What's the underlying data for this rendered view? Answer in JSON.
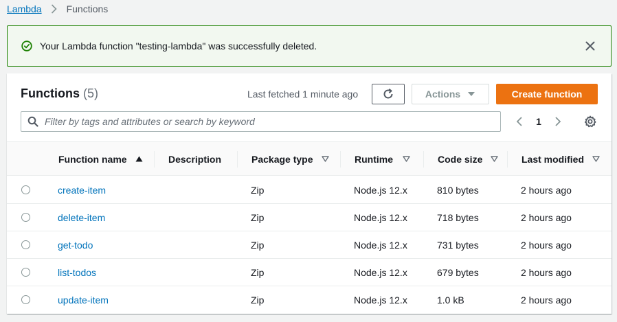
{
  "breadcrumb": {
    "parent": "Lambda",
    "current": "Functions"
  },
  "flash": {
    "message": "Your Lambda function \"testing-lambda\" was successfully deleted."
  },
  "panel": {
    "title": "Functions",
    "count": "(5)",
    "last_fetched": "Last fetched 1 minute ago",
    "actions_label": "Actions",
    "create_label": "Create function",
    "search_placeholder": "Filter by tags and attributes or search by keyword",
    "page": "1"
  },
  "table": {
    "columns": [
      "Function name",
      "Description",
      "Package type",
      "Runtime",
      "Code size",
      "Last modified"
    ],
    "rows": [
      {
        "name": "create-item",
        "description": "",
        "package_type": "Zip",
        "runtime": "Node.js 12.x",
        "code_size": "810 bytes",
        "last_modified": "2 hours ago"
      },
      {
        "name": "delete-item",
        "description": "",
        "package_type": "Zip",
        "runtime": "Node.js 12.x",
        "code_size": "718 bytes",
        "last_modified": "2 hours ago"
      },
      {
        "name": "get-todo",
        "description": "",
        "package_type": "Zip",
        "runtime": "Node.js 12.x",
        "code_size": "731 bytes",
        "last_modified": "2 hours ago"
      },
      {
        "name": "list-todos",
        "description": "",
        "package_type": "Zip",
        "runtime": "Node.js 12.x",
        "code_size": "679 bytes",
        "last_modified": "2 hours ago"
      },
      {
        "name": "update-item",
        "description": "",
        "package_type": "Zip",
        "runtime": "Node.js 12.x",
        "code_size": "1.0 kB",
        "last_modified": "2 hours ago"
      }
    ]
  },
  "colors": {
    "link": "#0073bb",
    "primary_button": "#ec7211",
    "success": "#1d8102",
    "success_bg": "#f2f8f0"
  },
  "icons": [
    "chevron-right-icon",
    "check-circle-icon",
    "close-icon",
    "refresh-icon",
    "caret-down-icon",
    "search-icon",
    "chevron-left-icon",
    "gear-icon",
    "sort-ascending-icon",
    "sort-icon"
  ]
}
